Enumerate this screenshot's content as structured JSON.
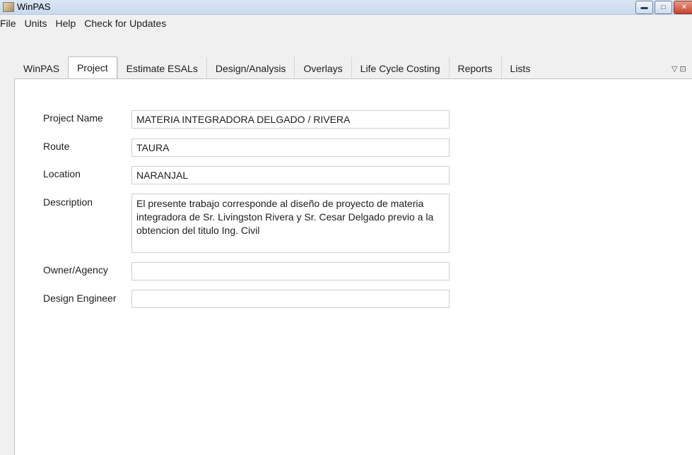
{
  "window": {
    "title": "WinPAS"
  },
  "menu": [
    "File",
    "Units",
    "Help",
    "Check for Updates"
  ],
  "tabs": [
    {
      "label": "WinPAS",
      "active": false
    },
    {
      "label": "Project",
      "active": true
    },
    {
      "label": "Estimate ESALs",
      "active": false
    },
    {
      "label": "Design/Analysis",
      "active": false
    },
    {
      "label": "Overlays",
      "active": false
    },
    {
      "label": "Life Cycle Costing",
      "active": false
    },
    {
      "label": "Reports",
      "active": false
    },
    {
      "label": "Lists",
      "active": false
    }
  ],
  "project": {
    "name_label": "Project Name",
    "name_value": "MATERIA INTEGRADORA DELGADO / RIVERA",
    "route_label": "Route",
    "route_value": "TAURA",
    "location_label": "Location",
    "location_value": "NARANJAL",
    "description_label": "Description",
    "description_value": "El presente trabajo corresponde al diseño de proyecto de materia integradora de Sr. Livingston Rivera y Sr. Cesar Delgado previo a la obtencion del titulo Ing. Civil",
    "owner_label": "Owner/Agency",
    "owner_value": "",
    "engineer_label": "Design Engineer",
    "engineer_value": ""
  },
  "icons": {
    "app": "winpas-app-icon",
    "minimize": "minimize-icon",
    "maximize": "maximize-icon",
    "close": "close-icon",
    "tab_menu": "tab-menu-icon"
  }
}
